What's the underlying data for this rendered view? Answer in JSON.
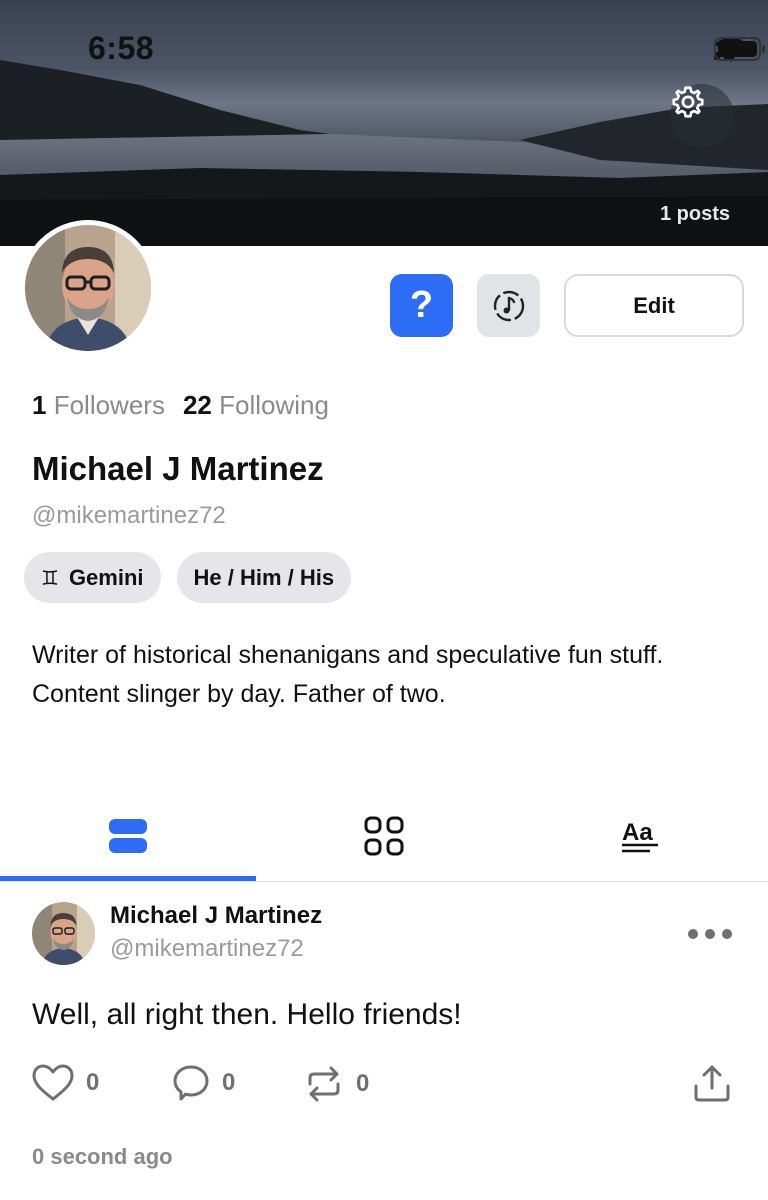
{
  "status_bar": {
    "time": "6:58"
  },
  "cover": {
    "posts_count": "1 posts"
  },
  "actions": {
    "question_label": "?",
    "edit_label": "Edit"
  },
  "profile": {
    "followers_count": "1",
    "followers_label": "Followers",
    "following_count": "22",
    "following_label": "Following",
    "display_name": "Michael J Martinez",
    "handle": "@mikemartinez72",
    "chips": [
      {
        "glyph": "♊",
        "label": "Gemini"
      },
      {
        "label": "He / Him / His"
      }
    ],
    "bio": "Writer of historical shenanigans and speculative fun stuff. Content slinger by day. Father of two."
  },
  "tabs": [
    {
      "icon": "list-view-icon",
      "active": true
    },
    {
      "icon": "grid-view-icon",
      "active": false
    },
    {
      "icon": "text-posts-icon",
      "active": false
    }
  ],
  "post": {
    "author_name": "Michael J Martinez",
    "author_handle": "@mikemartinez72",
    "text": "Well, all right then. Hello friends!",
    "likes": "0",
    "comments": "0",
    "reposts": "0",
    "timestamp": "0 second ago"
  },
  "colors": {
    "accent": "#2d6cf5",
    "chip_bg": "#e6e6ea",
    "muted_text": "#8a8a8e"
  }
}
